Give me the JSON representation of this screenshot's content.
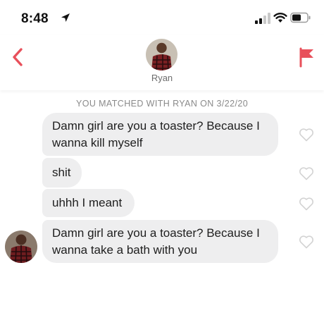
{
  "status_bar": {
    "time": "8:48",
    "icons": [
      "location-arrow-icon",
      "cellular-signal-icon",
      "wifi-icon",
      "battery-icon"
    ]
  },
  "header": {
    "name": "Ryan",
    "icons": [
      "chevron-left-icon",
      "report-flag-icon",
      "avatar"
    ]
  },
  "conversation": {
    "match_text": "YOU MATCHED WITH RYAN ON 3/22/20",
    "messages": [
      {
        "text_line1": "Damn girl are you a toaster? Because I",
        "text_line2": "wanna kill myself"
      },
      {
        "text": "shit"
      },
      {
        "text": "uhhh I meant"
      },
      {
        "text_line1": "Damn girl are you a toaster? Because I",
        "text_line2": "wanna take a bath with you"
      }
    ],
    "like_icon": "heart-outline-icon"
  },
  "colors": {
    "accent": "#e8505b",
    "bubble": "#eeeeef",
    "muted_text": "#8a8a8a"
  }
}
